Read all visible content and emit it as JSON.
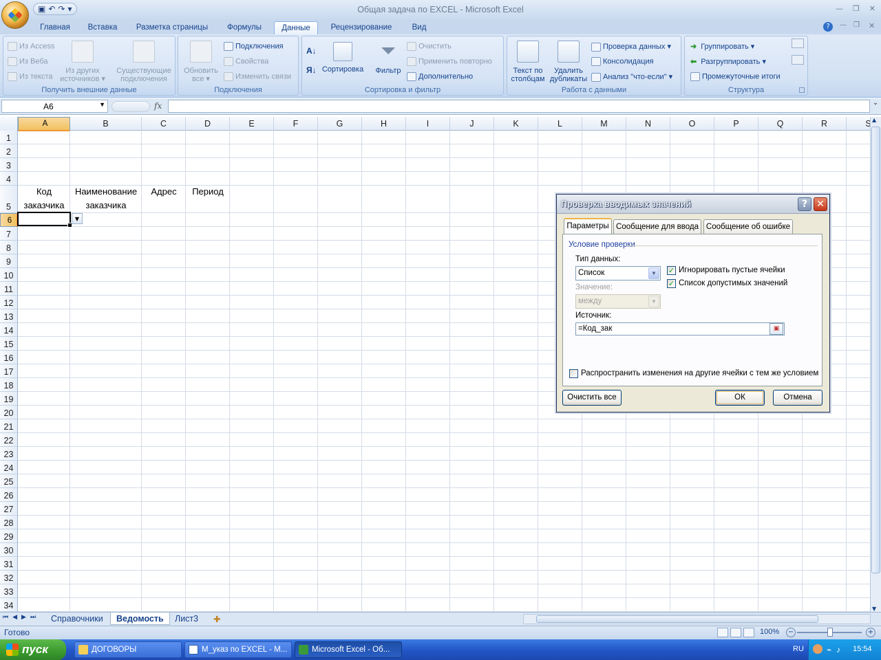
{
  "window": {
    "title": "Общая задача по EXCEL - Microsoft Excel",
    "qat": [
      "save-icon",
      "undo-icon",
      "redo-icon",
      "customize-icon"
    ]
  },
  "ribbon_tabs": [
    {
      "label": "Главная"
    },
    {
      "label": "Вставка"
    },
    {
      "label": "Разметка страницы"
    },
    {
      "label": "Формулы"
    },
    {
      "label": "Данные",
      "active": true
    },
    {
      "label": "Рецензирование"
    },
    {
      "label": "Вид"
    }
  ],
  "ribbon": {
    "external": {
      "label": "Получить внешние данные",
      "from_access": "Из Access",
      "from_web": "Из Веба",
      "from_text": "Из текста",
      "other_sources_1": "Из других",
      "other_sources_2": "источников",
      "existing_1": "Существующие",
      "existing_2": "подключения"
    },
    "connections": {
      "label": "Подключения",
      "refresh_1": "Обновить",
      "refresh_2": "все",
      "connections": "Подключения",
      "properties": "Свойства",
      "edit_links": "Изменить связи"
    },
    "sort": {
      "label": "Сортировка и фильтр",
      "sort": "Сортировка",
      "filter": "Фильтр",
      "clear": "Очистить",
      "reapply": "Применить повторно",
      "advanced": "Дополнительно"
    },
    "data_tools": {
      "label": "Работа с данными",
      "text_to_cols_1": "Текст по",
      "text_to_cols_2": "столбцам",
      "remove_dup_1": "Удалить",
      "remove_dup_2": "дубликаты",
      "validation": "Проверка данных",
      "consolidate": "Консолидация",
      "whatif": "Анализ \"что-если\""
    },
    "outline": {
      "label": "Структура",
      "group": "Группировать",
      "ungroup": "Разгруппировать",
      "subtotal": "Промежуточные итоги"
    }
  },
  "formula_bar": {
    "name_box": "A6",
    "fx": "fx",
    "formula": ""
  },
  "columns": [
    "A",
    "B",
    "C",
    "D",
    "E",
    "F",
    "G",
    "H",
    "I",
    "J",
    "K",
    "L",
    "M",
    "N",
    "O",
    "P",
    "Q",
    "R",
    "S"
  ],
  "rows": [
    "1",
    "2",
    "3",
    "4",
    "5",
    "6",
    "7",
    "8",
    "9",
    "10",
    "11",
    "12",
    "13",
    "14",
    "15",
    "16",
    "17",
    "18",
    "19",
    "20",
    "21",
    "22",
    "23",
    "24",
    "25",
    "26",
    "27",
    "28",
    "29",
    "30",
    "31",
    "32",
    "33",
    "34"
  ],
  "cells": {
    "a5_line1": "Код",
    "a5_line2": "заказчика",
    "b5_line1": "Наименование",
    "b5_line2": "заказчика",
    "c5": "Адрес",
    "d5": "Период"
  },
  "sheets": [
    {
      "label": "Справочники"
    },
    {
      "label": "Ведомость",
      "active": true
    },
    {
      "label": "Лист3"
    }
  ],
  "status": {
    "ready": "Готово",
    "zoom": "100%"
  },
  "dialog": {
    "title": "Проверка вводимых значений",
    "help": "?",
    "close": "✕",
    "tabs": [
      "Параметры",
      "Сообщение для ввода",
      "Сообщение об ошибке"
    ],
    "section": "Условие проверки",
    "type_label": "Тип данных:",
    "type_value": "Список",
    "ignore_blank": "Игнорировать пустые ячейки",
    "dropdown_list": "Список допустимых значений",
    "value_label": "Значение:",
    "value_value": "между",
    "source_label": "Источник:",
    "source_value": "=Код_зак",
    "apply_all": "Распространить изменения на другие ячейки с тем же условием",
    "clear_all": "Очистить все",
    "ok": "ОК",
    "cancel": "Отмена"
  },
  "taskbar": {
    "start": "пуск",
    "items": [
      {
        "label": "ДОГОВОРЫ"
      },
      {
        "label": "М_указ по EXCEL - M..."
      },
      {
        "label": "Microsoft Excel - Об...",
        "active": true
      }
    ],
    "lang": "RU",
    "clock": "15:54"
  },
  "colors": {
    "accent": "#15428b",
    "selected_header": "#f1c15f",
    "taskbar": "#2358c8",
    "start": "#3a9a2e"
  }
}
